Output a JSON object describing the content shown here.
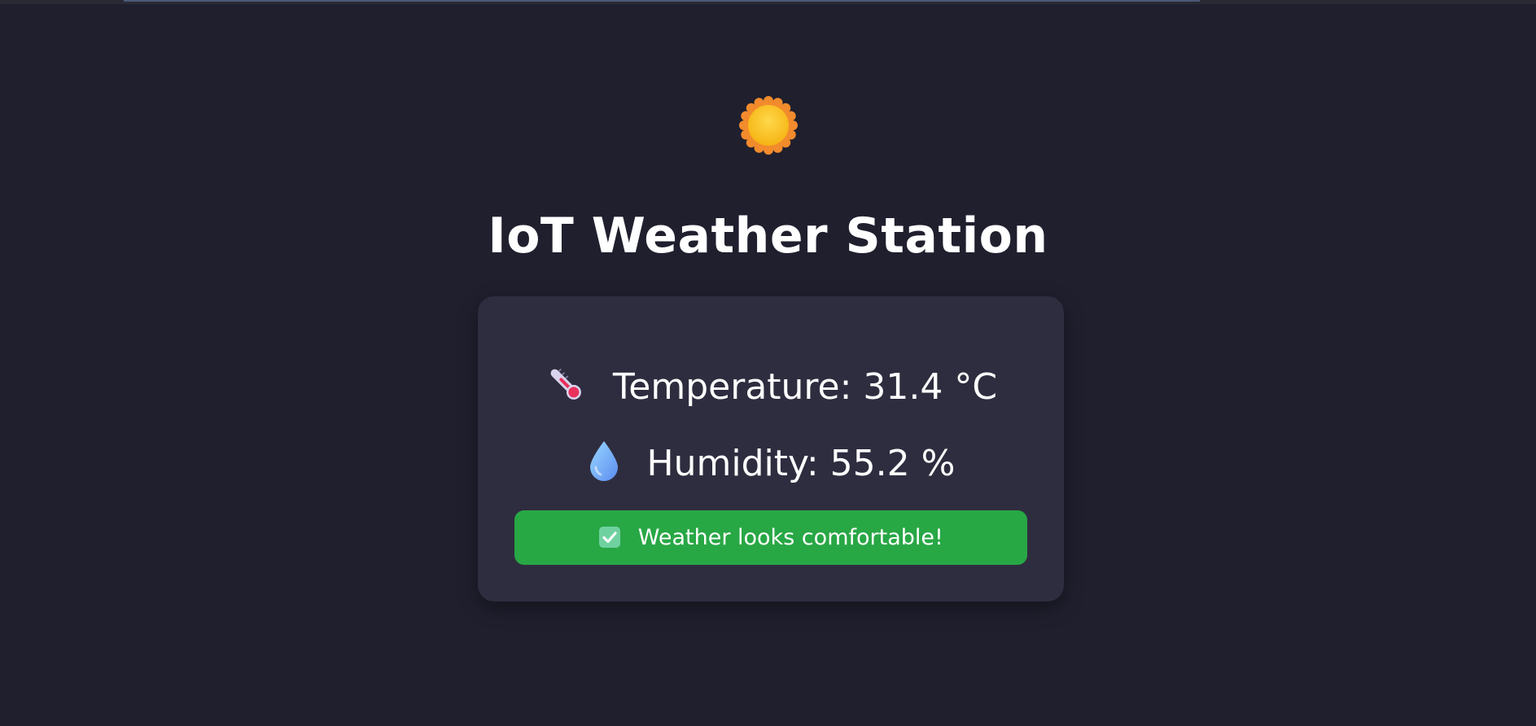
{
  "header": {
    "weather_icon": "sun-icon",
    "title": "IoT Weather Station"
  },
  "readings": {
    "temperature": {
      "icon": "thermometer-icon",
      "label": "Temperature: 31.4 °C"
    },
    "humidity": {
      "icon": "water-drop-icon",
      "label": "Humidity: 55.2 %"
    }
  },
  "status": {
    "icon": "check-mark-icon",
    "message": "Weather looks comfortable!",
    "color": "#28a745"
  },
  "colors": {
    "background": "#1f1f2e",
    "card": "#2e2d3f",
    "text": "#ffffff"
  }
}
